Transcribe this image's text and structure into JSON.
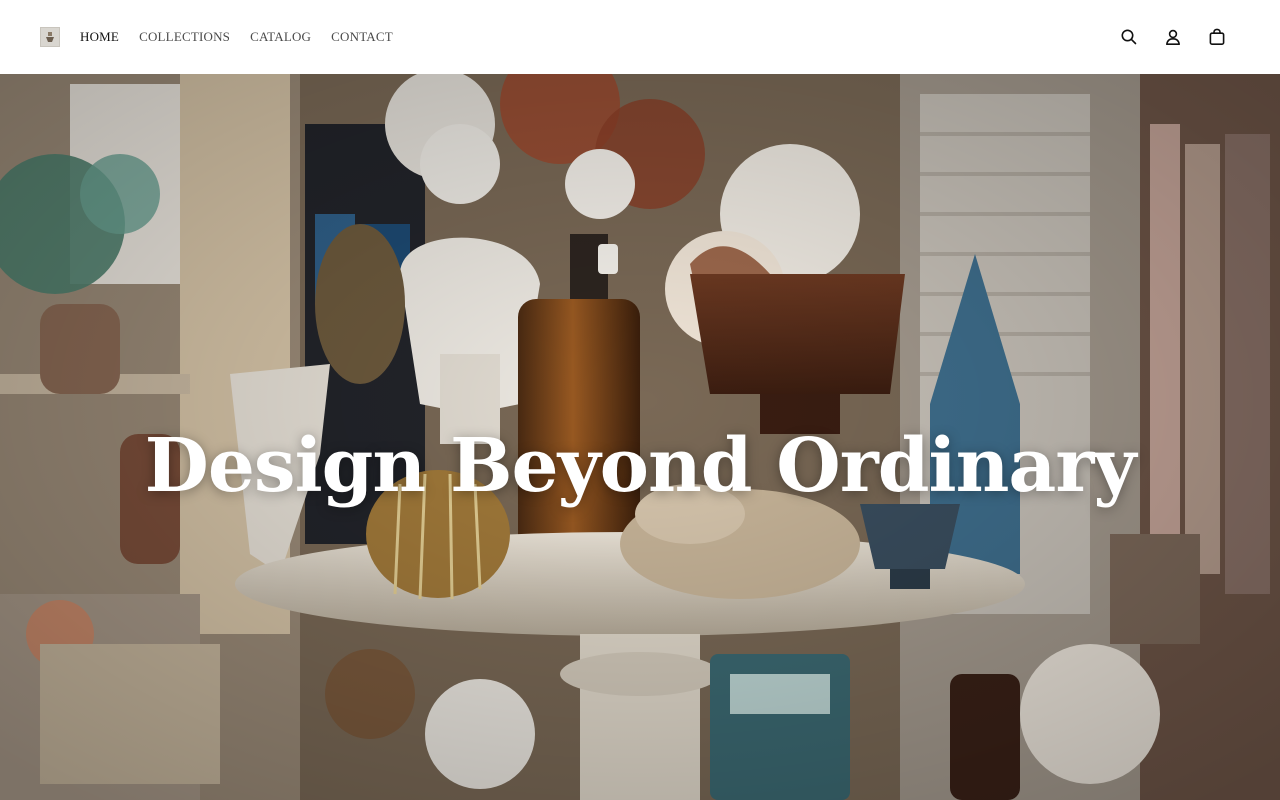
{
  "header": {
    "logo_icon": "shop-logo-icon",
    "nav": [
      {
        "label": "HOME",
        "active": true
      },
      {
        "label": "COLLECTIONS",
        "active": false
      },
      {
        "label": "CATALOG",
        "active": false
      },
      {
        "label": "CONTACT",
        "active": false
      }
    ],
    "icons": [
      "search-icon",
      "account-icon",
      "cart-icon"
    ]
  },
  "hero": {
    "title": "Design Beyond Ordinary"
  },
  "colors": {
    "nav_text": "#4a4a4a",
    "nav_active": "#111111",
    "hero_text": "#ffffff"
  }
}
